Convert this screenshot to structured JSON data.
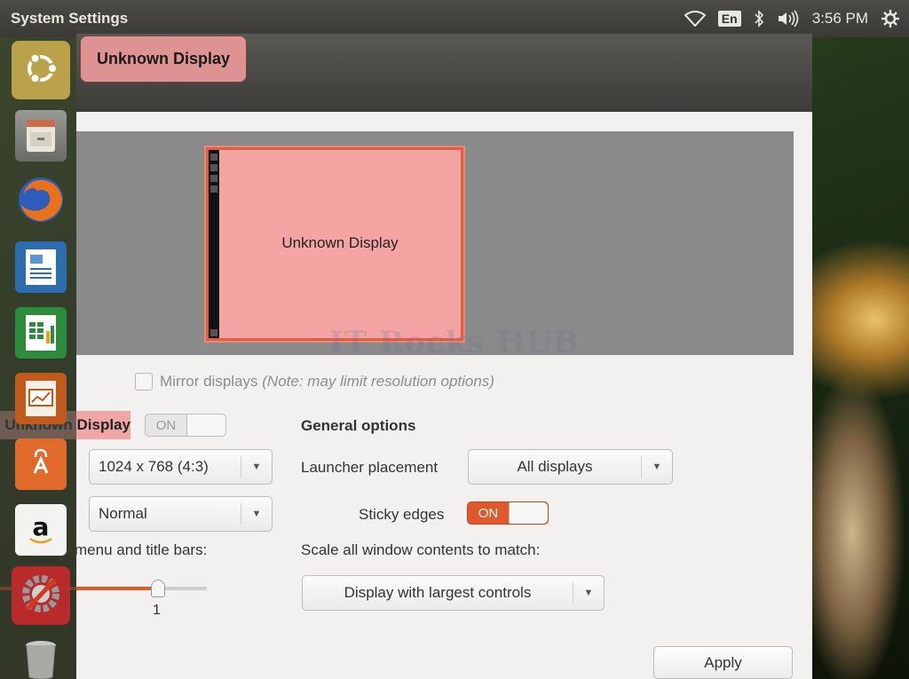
{
  "panel": {
    "app_title": "System Settings",
    "language": "En",
    "clock": "3:56 PM",
    "icons": [
      "wifi-icon",
      "bluetooth-icon",
      "volume-icon",
      "settings-gear-icon"
    ]
  },
  "launcher": {
    "items": [
      {
        "name": "ubuntu-dash"
      },
      {
        "name": "files"
      },
      {
        "name": "firefox"
      },
      {
        "name": "libreoffice-writer"
      },
      {
        "name": "libreoffice-calc"
      },
      {
        "name": "libreoffice-impress"
      },
      {
        "name": "ubuntu-software-center"
      },
      {
        "name": "amazon"
      },
      {
        "name": "system-settings"
      },
      {
        "name": "trash"
      }
    ]
  },
  "window": {
    "breadcrumb": "Unknown Display",
    "arrangement": {
      "monitor_label": "Unknown Display",
      "watermark": "IT Rocks HUB"
    },
    "mirror": {
      "label": "Mirror displays",
      "note": "(Note: may limit resolution options)",
      "checked": false
    },
    "display": {
      "name": "Unknown Display",
      "toggle": "ON",
      "resolution": "1024 x 768 (4:3)",
      "rotation": "Normal",
      "scale_label": "Scale for menu and title bars:",
      "scale_label_visible": "menu and title bars:",
      "scale_value": "1"
    },
    "general": {
      "heading": "General options",
      "launcher_placement_label": "Launcher placement",
      "launcher_placement_value": "All displays",
      "sticky_edges_label": "Sticky edges",
      "sticky_edges_toggle": "ON",
      "scale_all_label": "Scale all window contents to match:",
      "scale_all_value": "Display with largest controls"
    },
    "apply_label": "Apply"
  },
  "colors": {
    "accent": "#e0592a",
    "monitor_fill": "#f4a4a2",
    "selection": "#dd9391"
  }
}
